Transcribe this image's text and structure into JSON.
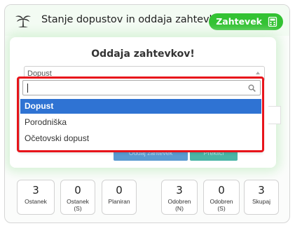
{
  "header": {
    "title": "Stanje dopustov in oddaja zahtevkov",
    "request_button": "Zahtevek"
  },
  "card": {
    "title": "Oddaja zahtevkov!",
    "select": {
      "value": "Dopust"
    },
    "buttons": {
      "primary": "Oddaj zahtevek",
      "secondary": "Prekliči"
    }
  },
  "dropdown": {
    "search_value": "",
    "options": [
      "Dopust",
      "Porodniška",
      "Očetovski dopust"
    ],
    "selected_index": 0
  },
  "stats": [
    {
      "value": "3",
      "label": "Ostanek"
    },
    {
      "value": "0",
      "label": "Ostanek (S)"
    },
    {
      "value": "0",
      "label": "Planiran"
    },
    {
      "value": "3",
      "label": "Odobren (N)"
    },
    {
      "value": "0",
      "label": "Odobren (S)"
    },
    {
      "value": "3",
      "label": "Skupaj"
    }
  ],
  "colors": {
    "accent_green": "#33c233",
    "selected_blue": "#2f73d3",
    "highlight_red": "#e8141b"
  }
}
